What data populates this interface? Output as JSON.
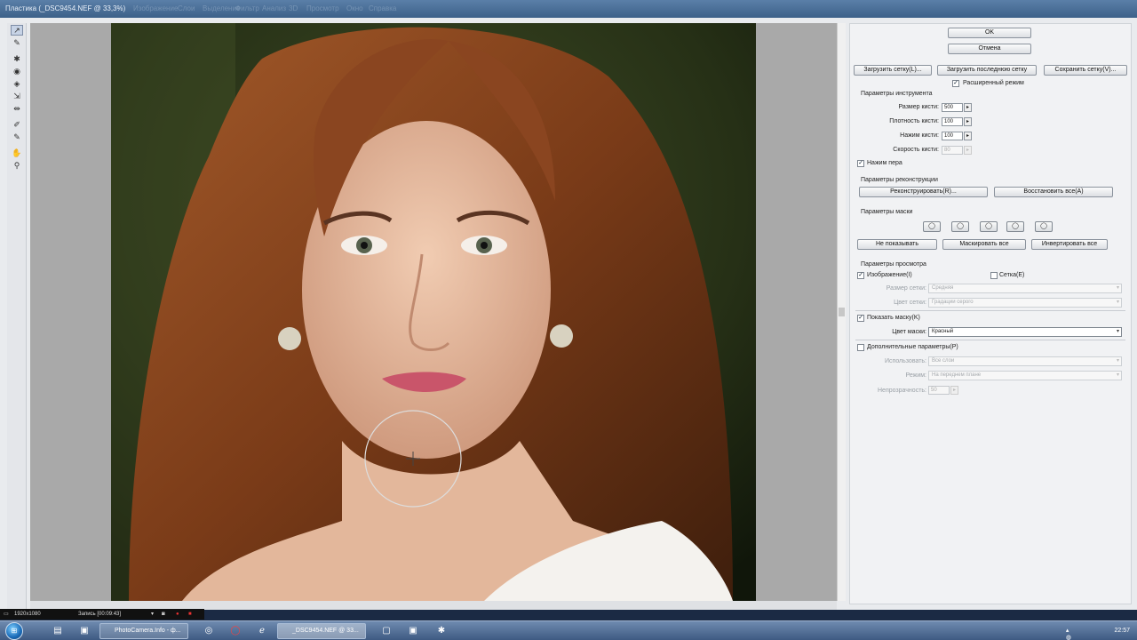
{
  "window": {
    "title": "Пластика (_DSC9454.NEF @ 33,3%)",
    "ghost_menu": [
      "Изображение",
      "Слои",
      "Выделение",
      "Фильтр",
      "Анализ",
      "3D",
      "Просмотр",
      "Окно",
      "Справка"
    ]
  },
  "tools": [
    {
      "name": "forward-warp-tool",
      "glyph": "↗"
    },
    {
      "name": "reconstruct-tool",
      "glyph": "✎"
    },
    {
      "name": "twirl-clockwise-tool",
      "glyph": "✱"
    },
    {
      "name": "pucker-tool",
      "glyph": "◉"
    },
    {
      "name": "bloat-tool",
      "glyph": "◈"
    },
    {
      "name": "push-left-tool",
      "glyph": "⇲"
    },
    {
      "name": "mirror-tool",
      "glyph": "⇹"
    },
    {
      "name": "freeze-mask-tool",
      "glyph": "✐"
    },
    {
      "name": "thaw-mask-tool",
      "glyph": "✎"
    },
    {
      "name": "hand-tool",
      "glyph": "✋"
    },
    {
      "name": "zoom-tool",
      "glyph": "⚲"
    }
  ],
  "buttons": {
    "ok": "OK",
    "cancel": "Отмена",
    "load_mesh": "Загрузить сетку(L)...",
    "load_last_mesh": "Загрузить последнюю сетку",
    "save_mesh": "Сохранить сетку(V)...",
    "reconstruct": "Реконструировать(R)...",
    "restore_all": "Восстановить все(A)",
    "none": "Не показывать",
    "mask_all": "Маскировать все",
    "invert_all": "Инвертировать все"
  },
  "advanced_mode": {
    "label": "Расширенный режим",
    "checked": true
  },
  "tool_options": {
    "heading": "Параметры инструмента",
    "brush_size": {
      "label": "Размер кисти:",
      "value": "500"
    },
    "brush_density": {
      "label": "Плотность кисти:",
      "value": "100"
    },
    "brush_pressure": {
      "label": "Нажим кисти:",
      "value": "100"
    },
    "brush_rate": {
      "label": "Скорость кисти:",
      "value": "80"
    },
    "stylus_pressure": {
      "label": "Нажим пера",
      "checked": true
    }
  },
  "reconstruct_options": {
    "heading": "Параметры реконструкции"
  },
  "mask_options": {
    "heading": "Параметры маски",
    "mode_glyphs": [
      "◯",
      "◯",
      "◯",
      "◯",
      "◯"
    ]
  },
  "view_options": {
    "heading": "Параметры просмотра",
    "show_image": {
      "label": "Изображение(I)",
      "checked": true
    },
    "show_mesh": {
      "label": "Сетка(E)",
      "checked": false
    },
    "mesh_size": {
      "label": "Размер сетки:",
      "value": "Средняя"
    },
    "mesh_color": {
      "label": "Цвет сетки:",
      "value": "Градации серого"
    },
    "show_mask": {
      "label": "Показать маску(K)",
      "checked": true
    },
    "mask_color": {
      "label": "Цвет маски:",
      "value": "Красный"
    },
    "show_backdrop": {
      "label": "Дополнительные параметры(P)",
      "checked": false
    },
    "use": {
      "label": "Использовать:",
      "value": "Все слои"
    },
    "mode": {
      "label": "Режим:",
      "value": "На переднем плане"
    },
    "opacity": {
      "label": "Непрозрачность:",
      "value": "50"
    }
  },
  "recorder": {
    "resolution": "1920x1080",
    "status": "Запись [00:09:43]"
  },
  "taskbar": {
    "tasks": [
      {
        "label": "PhotoCamera.Info - ф...",
        "active": false
      },
      {
        "label": "_DSC9454.NEF @ 33...",
        "active": true
      }
    ],
    "clock": "22:57"
  },
  "colors": {
    "titlebar": "#4d729c",
    "panel": "#f1f2f4",
    "canvas_bg": "#a9a9a9",
    "taskbar": "#4f6d96"
  }
}
